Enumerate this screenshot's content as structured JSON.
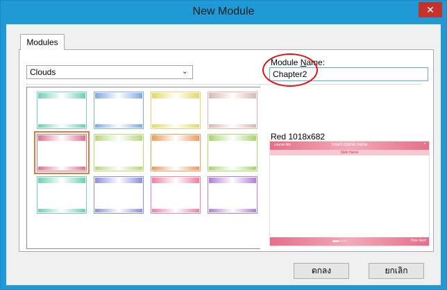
{
  "window": {
    "title": "New Module",
    "close_icon": "close-icon",
    "accent": "#1f9ad6"
  },
  "tabs": [
    {
      "label": "Modules"
    }
  ],
  "template_select": {
    "value": "Clouds",
    "icon": "chevron-down-icon"
  },
  "module_name": {
    "label_prefix": "Module ",
    "label_underlined": "N",
    "label_suffix": "ame:",
    "value": "Chapter2"
  },
  "templates": [
    {
      "color": "#6fcfb8"
    },
    {
      "color": "#7fa8e6"
    },
    {
      "color": "#e2d86a"
    },
    {
      "color": "#d8b7b0"
    },
    {
      "color": "#e56f8a"
    },
    {
      "color": "#b9d77a"
    },
    {
      "color": "#f09a5a"
    },
    {
      "color": "#a6d86a"
    },
    {
      "color": "#6fcfb0"
    },
    {
      "color": "#8a8fe0"
    },
    {
      "color": "#f07fa0"
    },
    {
      "color": "#b07fd8"
    }
  ],
  "selected_template_index": 4,
  "preview": {
    "label": "Red 1018x682",
    "course_title": "Insert course name",
    "slide_title": "Slide Name",
    "course_tag": "course title",
    "nav_text": "Prev  Next"
  },
  "buttons": {
    "ok": "ตกลง",
    "cancel": "ยกเลิก"
  }
}
